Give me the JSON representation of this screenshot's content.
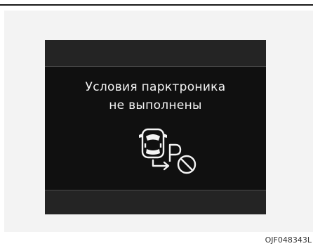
{
  "display": {
    "message_line_1": "Условия парктроника",
    "message_line_2": "не выполнены",
    "pictogram": "car-parking-assist-unavailable-icon"
  },
  "figure": {
    "code": "OJF048343L"
  },
  "colors": {
    "display_background": "#101010",
    "display_band": "#242424",
    "display_text": "#f4f4f4",
    "figure_background": "#f3f3f3"
  }
}
